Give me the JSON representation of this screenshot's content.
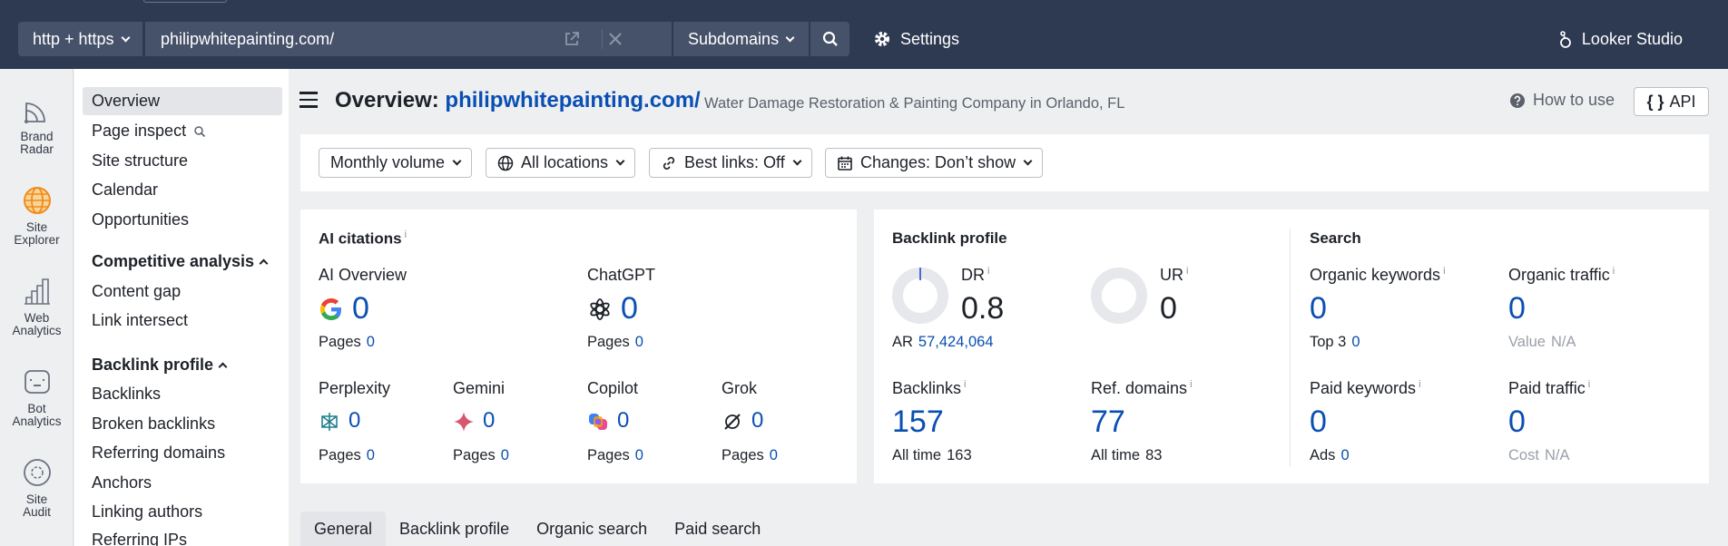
{
  "topbar": {
    "protocol": "http + https",
    "url": "philipwhitepainting.com/",
    "scope": "Subdomains",
    "settings": "Settings",
    "looker": "Looker Studio"
  },
  "rail": [
    {
      "label1": "Brand",
      "label2": "Radar",
      "icon": "brand-radar-icon"
    },
    {
      "label1": "Site",
      "label2": "Explorer",
      "icon": "site-explorer-icon"
    },
    {
      "label1": "Web",
      "label2": "Analytics",
      "icon": "web-analytics-icon"
    },
    {
      "label1": "Bot",
      "label2": "Analytics",
      "icon": "bot-analytics-icon"
    },
    {
      "label1": "Site",
      "label2": "Audit",
      "icon": "site-audit-icon"
    }
  ],
  "nav": {
    "items_top": [
      "Overview",
      "Page inspect",
      "Site structure",
      "Calendar",
      "Opportunities"
    ],
    "competitive_head": "Competitive analysis",
    "competitive_items": [
      "Content gap",
      "Link intersect"
    ],
    "backlink_head": "Backlink profile",
    "backlink_items": [
      "Backlinks",
      "Broken backlinks",
      "Referring domains",
      "Anchors",
      "Linking authors",
      "Referring IPs"
    ]
  },
  "header": {
    "title_prefix": "Overview:",
    "title_domain": "philipwhitepainting.com/",
    "description": "Water Damage Restoration & Painting Company in Orlando, FL",
    "how_to": "How to use",
    "api": "API"
  },
  "filters": [
    "Monthly volume",
    "All locations",
    "Best links: Off",
    "Changes: Don’t show"
  ],
  "ai": {
    "title": "AI citations",
    "pages_label": "Pages",
    "overview": {
      "name": "AI Overview",
      "value": "0",
      "pages": "0"
    },
    "chatgpt": {
      "name": "ChatGPT",
      "value": "0",
      "pages": "0"
    },
    "perplexity": {
      "name": "Perplexity",
      "value": "0",
      "pages": "0"
    },
    "gemini": {
      "name": "Gemini",
      "value": "0",
      "pages": "0"
    },
    "copilot": {
      "name": "Copilot",
      "value": "0",
      "pages": "0"
    },
    "grok": {
      "name": "Grok",
      "value": "0",
      "pages": "0"
    }
  },
  "backlink": {
    "title": "Backlink profile",
    "dr_label": "DR",
    "dr": "0.8",
    "ur_label": "UR",
    "ur": "0",
    "ar_label": "AR",
    "ar": "57,424,064",
    "backlinks_label": "Backlinks",
    "backlinks": "157",
    "backlinks_alltime_label": "All time",
    "backlinks_alltime": "163",
    "refdomains_label": "Ref. domains",
    "refdomains": "77",
    "refdomains_alltime_label": "All time",
    "refdomains_alltime": "83"
  },
  "search": {
    "title": "Search",
    "ok_label": "Organic keywords",
    "ok": "0",
    "top3_label": "Top 3",
    "top3": "0",
    "ot_label": "Organic traffic",
    "ot": "0",
    "value_label": "Value",
    "value": "N/A",
    "pk_label": "Paid keywords",
    "pk": "0",
    "ads_label": "Ads",
    "ads": "0",
    "pt_label": "Paid traffic",
    "pt": "0",
    "cost_label": "Cost",
    "cost": "N/A"
  },
  "tabs": [
    "General",
    "Backlink profile",
    "Organic search",
    "Paid search"
  ],
  "colors": {
    "topbar": "#2e3a52",
    "link": "#0a4fb3",
    "accent": "#f28c18"
  }
}
